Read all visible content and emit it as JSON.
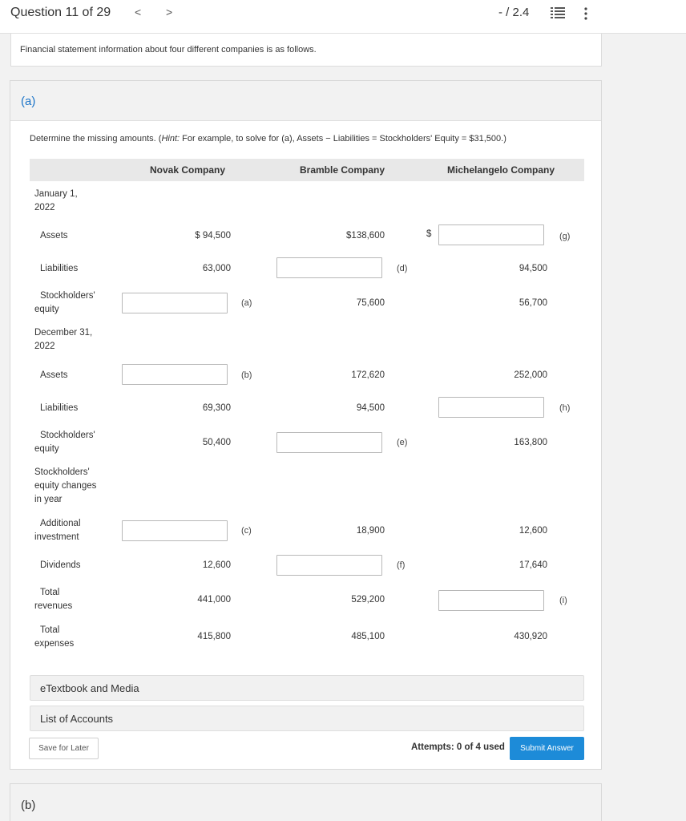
{
  "topbar": {
    "question": "Question 11 of 29",
    "prev": "<",
    "next": ">",
    "score": "- / 2.4",
    "more": "⋮"
  },
  "intro": "Financial statement information about four different companies is as follows.",
  "part_a": {
    "label": "(a)",
    "instruction_pre": "Determine the missing amounts. (",
    "instruction_hint": "Hint:",
    "instruction_post": " For example, to solve for (a), Assets − Liabilities = Stockholders' Equity = $31,500.)",
    "columns": [
      "Novak Company",
      "Bramble Company",
      "Michelangelo Company"
    ],
    "rows": {
      "jan_label_1": "January 1,",
      "jan_label_2": "2022",
      "assets_label": "Assets",
      "liab_label": "Liabilities",
      "se_label_1": "Stockholders'",
      "se_label_2": "equity",
      "dec_label_1": "December 31,",
      "dec_label_2": "2022",
      "assets2_label": "Assets",
      "liab2_label": "Liabilities",
      "se2_label_1": "Stockholders'",
      "se2_label_2": "equity",
      "sec_label_1": "Stockholders'",
      "sec_label_2": "equity changes",
      "sec_label_3": "in year",
      "addinv_label_1": "Additional",
      "addinv_label_2": "investment",
      "div_label": "Dividends",
      "rev_label_1": "Total",
      "rev_label_2": "revenues",
      "exp_label_1": "Total",
      "exp_label_2": "expenses"
    },
    "values": {
      "novak_assets": "$ 94,500",
      "bramble_assets": "$138,600",
      "mich_dollar": "$",
      "novak_liab": "63,000",
      "mich_liab": "94,500",
      "bramble_se": "75,600",
      "mich_se": "56,700",
      "bramble_assets2": "172,620",
      "mich_assets2": "252,000",
      "novak_liab2": "69,300",
      "bramble_liab2": "94,500",
      "novak_se2": "50,400",
      "mich_se2": "163,800",
      "bramble_addinv": "18,900",
      "mich_addinv": "12,600",
      "novak_div": "12,600",
      "mich_div": "17,640",
      "novak_rev": "441,000",
      "bramble_rev": "529,200",
      "novak_exp": "415,800",
      "bramble_exp": "485,100",
      "mich_exp": "430,920"
    },
    "letters": {
      "g": "(g)",
      "d": "(d)",
      "a": "(a)",
      "b": "(b)",
      "h": "(h)",
      "e": "(e)",
      "c": "(c)",
      "f": "(f)",
      "i": "(i)"
    },
    "etextbook": "eTextbook and Media",
    "accounts": "List of Accounts",
    "save": "Save for Later",
    "attempts": "Attempts: 0 of 4 used",
    "submit": "Submit Answer"
  },
  "part_b": {
    "label": "(b)"
  }
}
